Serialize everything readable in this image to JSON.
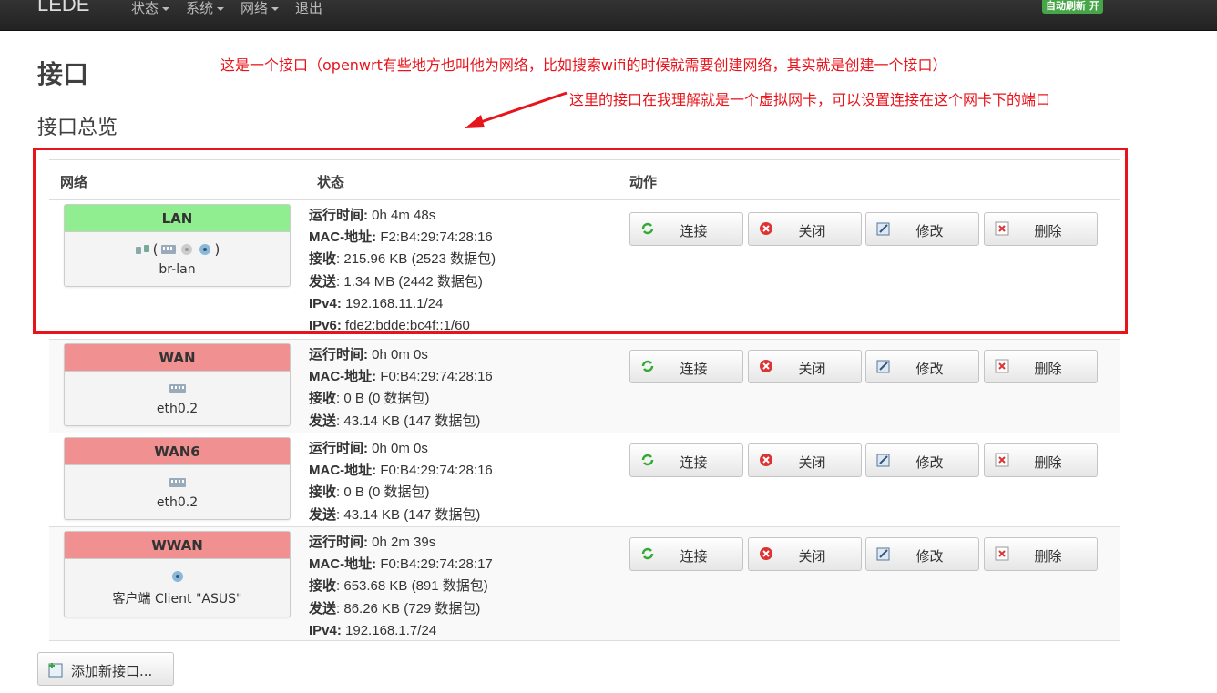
{
  "navbar": {
    "brand": "LEDE",
    "menu": [
      {
        "label": "状态",
        "dropdown": true
      },
      {
        "label": "系统",
        "dropdown": true
      },
      {
        "label": "网络",
        "dropdown": true
      },
      {
        "label": "退出",
        "dropdown": false
      }
    ],
    "auto_refresh": "自动刷新 开"
  },
  "page_title": "接口",
  "section_title": "接口总览",
  "annotations": {
    "note1": "这是一个接口（openwrt有些地方也叫他为网络，比如搜索wifi的时候就需要创建网络，其实就是创建一个接口）",
    "note2": "这里的接口在我理解就是一个虚拟网卡，可以设置连接在这个网卡下的端口"
  },
  "table": {
    "headers": {
      "network": "网络",
      "status": "状态",
      "actions": "动作"
    },
    "action_labels": {
      "connect": "连接",
      "stop": "关闭",
      "edit": "修改",
      "delete": "删除"
    },
    "rows": [
      {
        "name": "LAN",
        "color": "#90ee90",
        "device": "br-lan",
        "uptime_label": "运行时间:",
        "uptime": "0h 4m 48s",
        "mac_label": "MAC-地址:",
        "mac": "F2:B4:29:74:28:16",
        "rx_label": "接收",
        "rx": ": 215.96 KB (2523 数据包)",
        "tx_label": "发送",
        "tx": ": 1.34 MB (2442 数据包)",
        "ipv4_label": "IPv4:",
        "ipv4": "192.168.11.1/24",
        "ipv6_label": "IPv6:",
        "ipv6": "fde2:bdde:bc4f::1/60"
      },
      {
        "name": "WAN",
        "color": "#f09090",
        "device": "eth0.2",
        "uptime_label": "运行时间:",
        "uptime": "0h 0m 0s",
        "mac_label": "MAC-地址:",
        "mac": "F0:B4:29:74:28:16",
        "rx_label": "接收",
        "rx": ": 0 B (0 数据包)",
        "tx_label": "发送",
        "tx": ": 43.14 KB (147 数据包)"
      },
      {
        "name": "WAN6",
        "color": "#f09090",
        "device": "eth0.2",
        "uptime_label": "运行时间:",
        "uptime": "0h 0m 0s",
        "mac_label": "MAC-地址:",
        "mac": "F0:B4:29:74:28:16",
        "rx_label": "接收",
        "rx": ": 0 B (0 数据包)",
        "tx_label": "发送",
        "tx": ": 43.14 KB (147 数据包)"
      },
      {
        "name": "WWAN",
        "color": "#f09090",
        "device": "客户端 Client \"ASUS\"",
        "uptime_label": "运行时间:",
        "uptime": "0h 2m 39s",
        "mac_label": "MAC-地址:",
        "mac": "F0:B4:29:74:28:17",
        "rx_label": "接收",
        "rx": ": 653.68 KB (891 数据包)",
        "tx_label": "发送",
        "tx": ": 86.26 KB (729 数据包)",
        "ipv4_label": "IPv4:",
        "ipv4": "192.168.1.7/24"
      }
    ]
  },
  "add_interface_label": "添加新接口..."
}
